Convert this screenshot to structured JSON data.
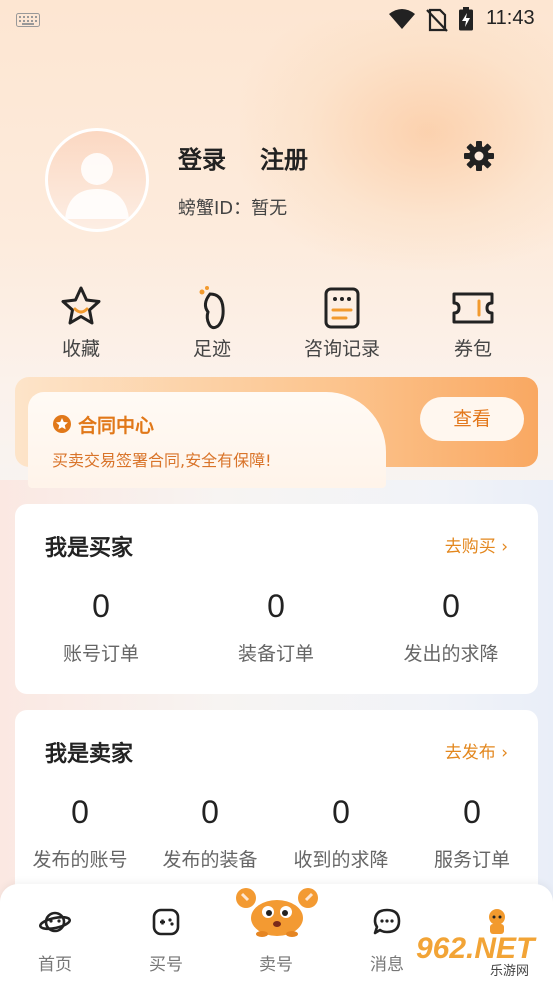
{
  "status_bar": {
    "time": "11:43",
    "icons": [
      "keyboard-icon",
      "wifi-icon",
      "no-sim-icon",
      "battery-charging-icon"
    ]
  },
  "profile": {
    "login_label": "登录",
    "register_label": "注册",
    "id_label": "螃蟹ID：暂无"
  },
  "quick_links": [
    {
      "label": "收藏",
      "icon": "star-smile-icon"
    },
    {
      "label": "足迹",
      "icon": "footprint-icon"
    },
    {
      "label": "咨询记录",
      "icon": "consult-record-icon"
    },
    {
      "label": "券包",
      "icon": "coupon-icon"
    }
  ],
  "contract": {
    "title": "合同中心",
    "description": "买卖交易签署合同,安全有保障!",
    "button_label": "查看",
    "accent": "#E17819"
  },
  "buyer": {
    "title": "我是买家",
    "link": "去购买 ›",
    "stats": [
      {
        "value": "0",
        "label": "账号订单"
      },
      {
        "value": "0",
        "label": "装备订单"
      },
      {
        "value": "0",
        "label": "发出的求降"
      }
    ]
  },
  "seller": {
    "title": "我是卖家",
    "link": "去发布 ›",
    "stats": [
      {
        "value": "0",
        "label": "发布的账号"
      },
      {
        "value": "0",
        "label": "发布的装备"
      },
      {
        "value": "0",
        "label": "收到的求降"
      },
      {
        "value": "0",
        "label": "服务订单"
      }
    ]
  },
  "bottom_nav": [
    {
      "label": "首页",
      "icon": "planet-icon"
    },
    {
      "label": "买号",
      "icon": "gamepad-icon"
    },
    {
      "label": "卖号",
      "icon": "crab-icon"
    },
    {
      "label": "消息",
      "icon": "chat-bubble-icon"
    },
    {
      "label": "",
      "icon": "user-icon"
    }
  ],
  "watermark": {
    "main": "962.NET",
    "sub": "乐游网"
  }
}
